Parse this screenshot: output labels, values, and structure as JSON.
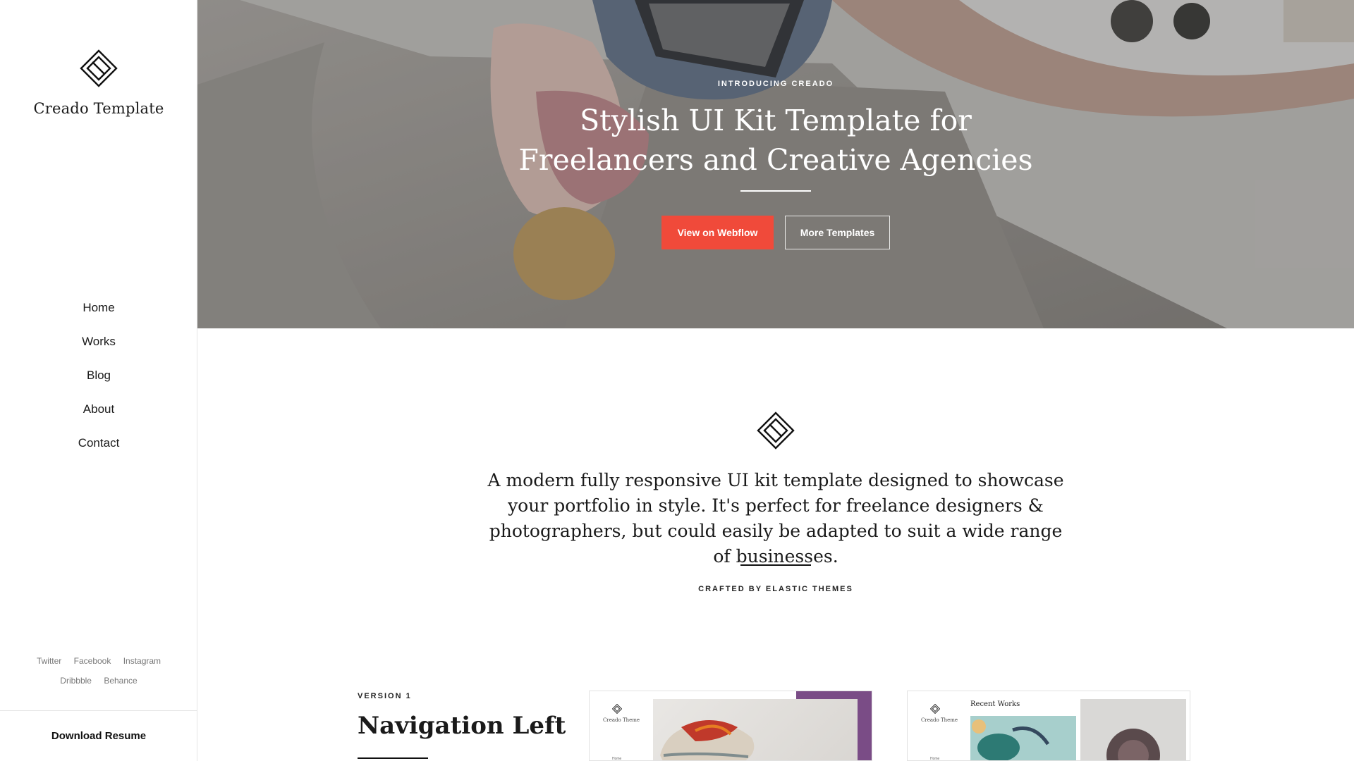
{
  "sidebar": {
    "brand": "Creado Template",
    "nav": [
      "Home",
      "Works",
      "Blog",
      "About",
      "Contact"
    ],
    "social": {
      "row1": [
        "Twitter",
        "Facebook",
        "Instagram"
      ],
      "row2": [
        "Dribbble",
        "Behance"
      ]
    },
    "download_label": "Download Resume"
  },
  "hero": {
    "eyebrow": "INTRODUCING CREADO",
    "title": "Stylish UI Kit Template for Freelancers and Creative Agencies",
    "primary_button": "View on Webflow",
    "secondary_button": "More Templates"
  },
  "intro": {
    "text": "A modern fully responsive UI kit template designed to showcase your portfolio in style. It's perfect for freelance designers & photographers, but could easily be adapted to suit a wide range of businesses.",
    "crafted": "CRAFTED BY ELASTIC THEMES"
  },
  "versions": {
    "label": "VERSION 1",
    "title": "Navigation Left",
    "thumb1": {
      "brand": "Creado Theme",
      "nav": "Home"
    },
    "thumb2": {
      "brand": "Creado Theme",
      "heading": "Recent Works",
      "nav": "Home"
    }
  },
  "colors": {
    "accent": "#f04a3a",
    "thumb_purple": "#7a4c86"
  }
}
